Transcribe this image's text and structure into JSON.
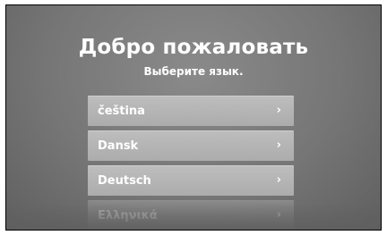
{
  "header": {
    "title": "Добро пожаловать",
    "subtitle": "Выберите язык."
  },
  "languages": [
    {
      "label": "čeština",
      "chevron": "›"
    },
    {
      "label": "Dansk",
      "chevron": "›"
    },
    {
      "label": "Deutsch",
      "chevron": "›"
    },
    {
      "label": "Ελληνικά",
      "chevron": "›"
    }
  ]
}
